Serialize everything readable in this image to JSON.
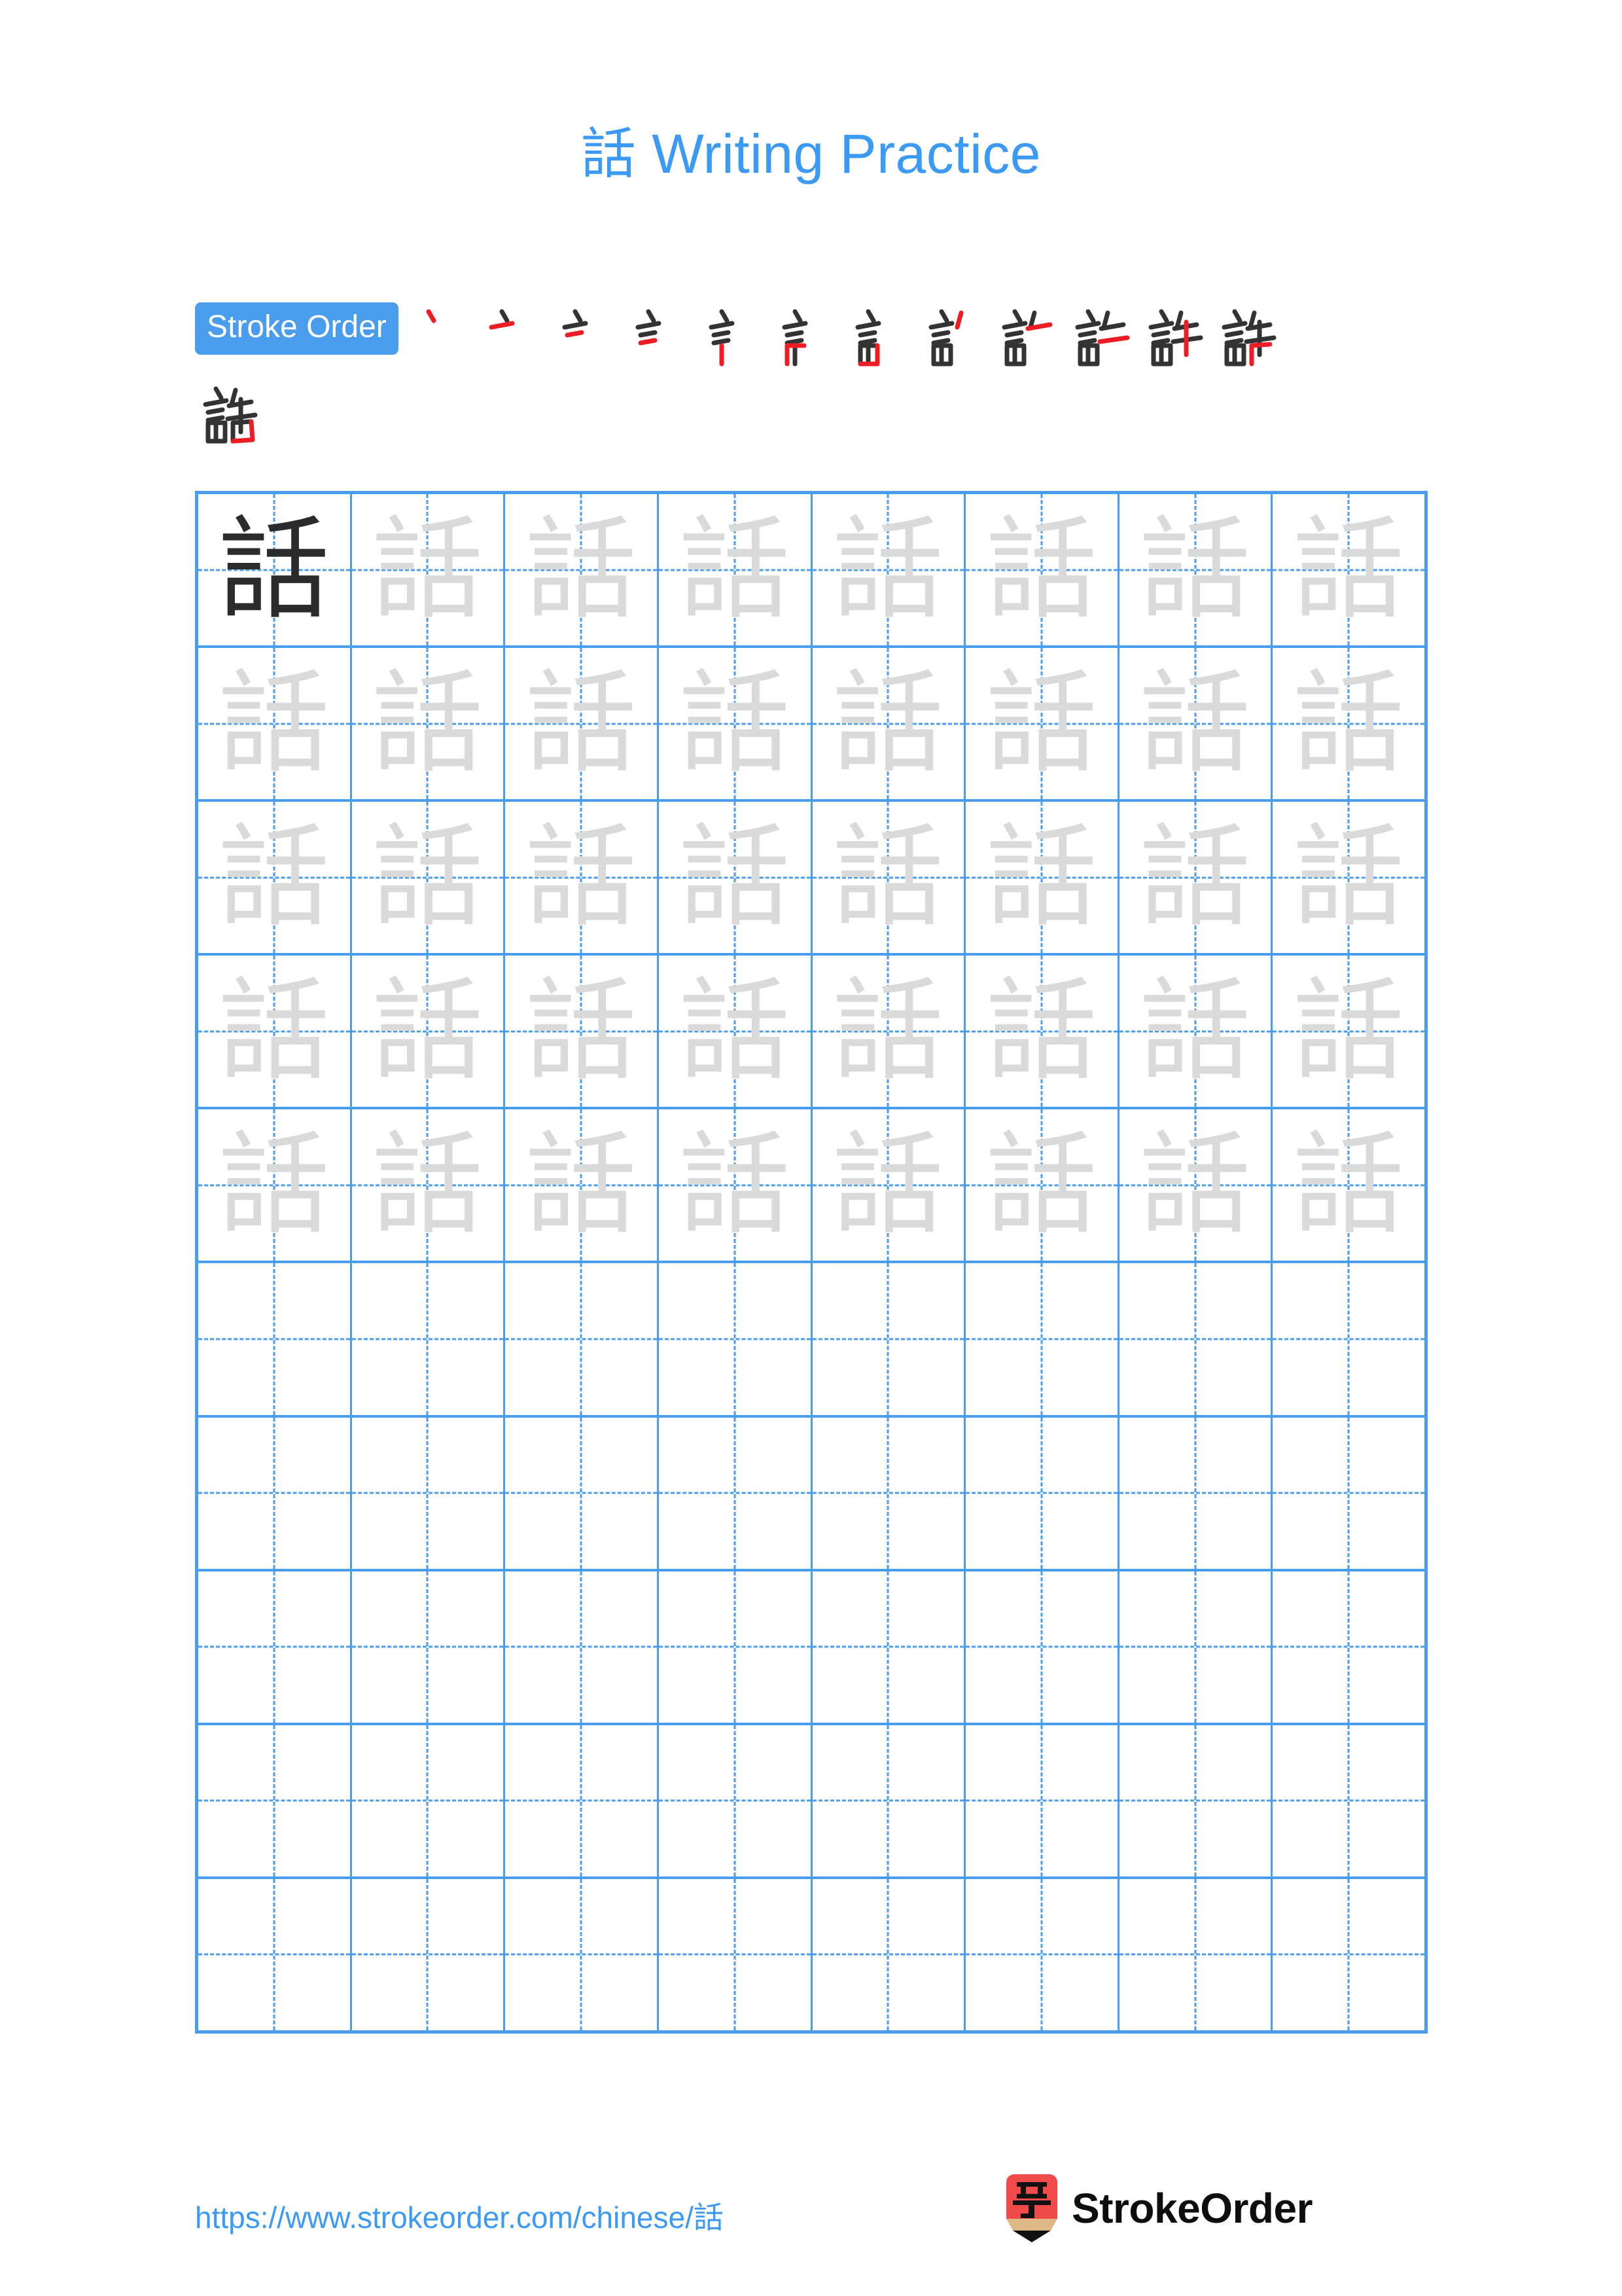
{
  "page": {
    "character": "話",
    "title_character": "話",
    "title_text": "Writing Practice",
    "title_full": "話 Writing Practice",
    "background_color": "#ffffff",
    "accent_color": "#4a9ced",
    "title_color": "#3b9af5",
    "trace_color": "#dadada",
    "model_color": "#2b2b2b",
    "new_stroke_color": "#ee1c25"
  },
  "stroke_order": {
    "badge_label": "Stroke Order",
    "total_strokes": 13,
    "steps_row1_count": 12,
    "steps_row2_count": 1,
    "steps": [
      {
        "index": 1,
        "partial": "丶"
      },
      {
        "index": 2,
        "partial": "亠"
      },
      {
        "index": 3,
        "partial": "三点"
      },
      {
        "index": 4,
        "partial": "言上"
      },
      {
        "index": 5,
        "partial": "言半"
      },
      {
        "index": 6,
        "partial": "言"
      },
      {
        "index": 7,
        "partial": "言口"
      },
      {
        "index": 8,
        "partial": "訁丿"
      },
      {
        "index": 9,
        "partial": "訁一"
      },
      {
        "index": 10,
        "partial": "訐"
      },
      {
        "index": 11,
        "partial": "訐丨"
      },
      {
        "index": 12,
        "partial": "話上"
      },
      {
        "index": 13,
        "partial": "話"
      }
    ]
  },
  "practice_grid": {
    "columns": 8,
    "rows": 10,
    "filled_rows": 5,
    "empty_rows": 5,
    "model_cell": {
      "row": 1,
      "column": 1
    },
    "guides": {
      "vertical": "dashed",
      "horizontal": "dashed"
    },
    "cells": [
      [
        "話",
        "話",
        "話",
        "話",
        "話",
        "話",
        "話",
        "話"
      ],
      [
        "話",
        "話",
        "話",
        "話",
        "話",
        "話",
        "話",
        "話"
      ],
      [
        "話",
        "話",
        "話",
        "話",
        "話",
        "話",
        "話",
        "話"
      ],
      [
        "話",
        "話",
        "話",
        "話",
        "話",
        "話",
        "話",
        "話"
      ],
      [
        "話",
        "話",
        "話",
        "話",
        "話",
        "話",
        "話",
        "話"
      ],
      [
        "",
        "",
        "",
        "",
        "",
        "",
        "",
        ""
      ],
      [
        "",
        "",
        "",
        "",
        "",
        "",
        "",
        ""
      ],
      [
        "",
        "",
        "",
        "",
        "",
        "",
        "",
        ""
      ],
      [
        "",
        "",
        "",
        "",
        "",
        "",
        "",
        ""
      ],
      [
        "",
        "",
        "",
        "",
        "",
        "",
        "",
        ""
      ]
    ]
  },
  "footer": {
    "url": "https://www.strokeorder.com/chinese/話",
    "brand_name": "StrokeOrder",
    "logo_character": "字",
    "logo_body_color": "#f04a4a",
    "logo_wood_color": "#deb887",
    "logo_tip_color": "#111111"
  }
}
